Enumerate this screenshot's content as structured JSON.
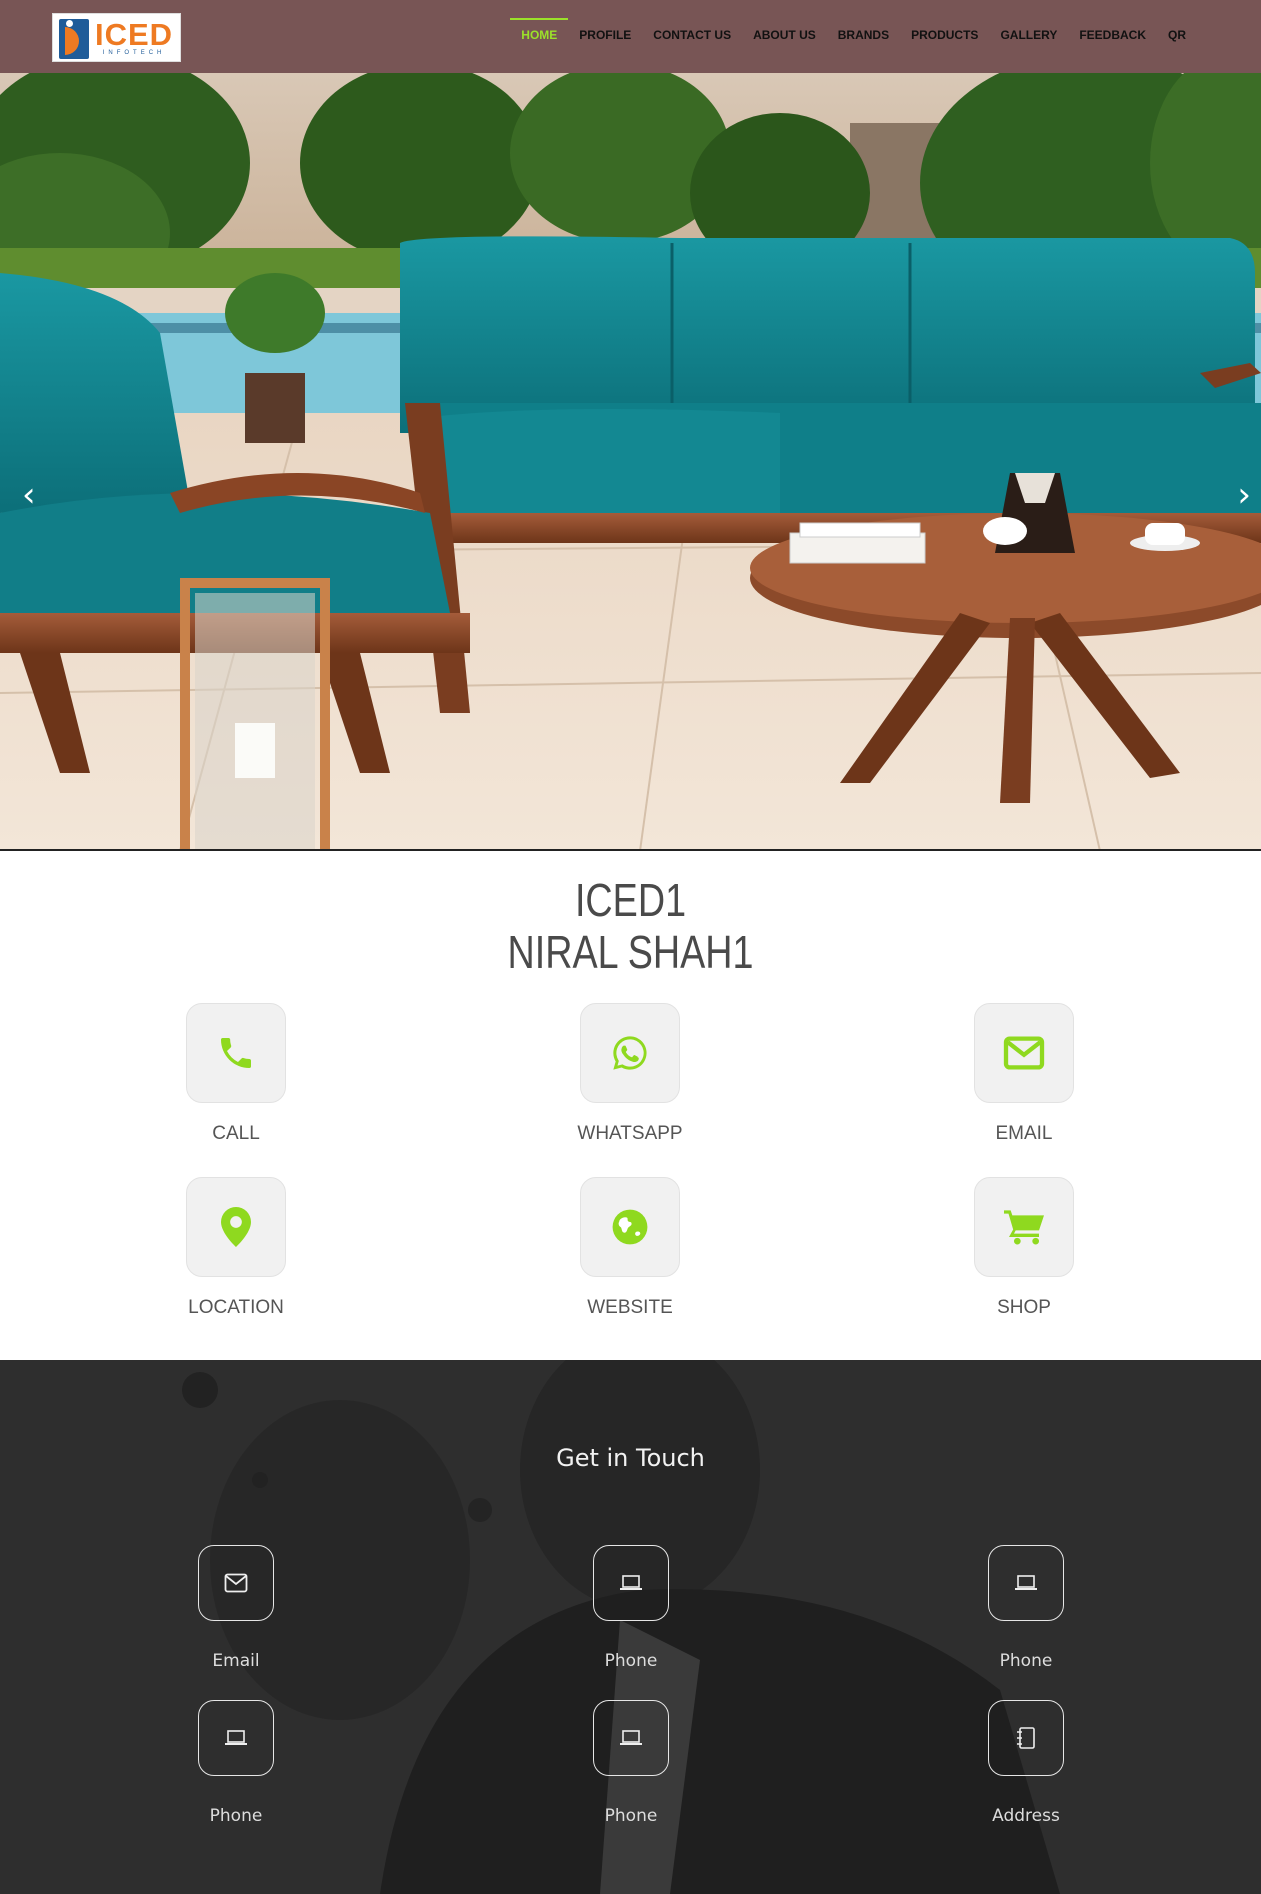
{
  "header": {
    "logo": {
      "text": "ICED",
      "subtext": "INFOTECH"
    },
    "nav": [
      "HOME",
      "PROFILE",
      "CONTACT US",
      "ABOUT US",
      "BRANDS",
      "PRODUCTS",
      "GALLERY",
      "FEEDBACK",
      "QR"
    ],
    "active_nav": "HOME"
  },
  "hero": {
    "prev_icon": "chevron-left-icon",
    "next_icon": "chevron-right-icon"
  },
  "profile": {
    "company": "ICED1",
    "person": "NIRAL SHAH1"
  },
  "actions": [
    {
      "label": "CALL",
      "icon": "phone-icon"
    },
    {
      "label": "WHATSAPP",
      "icon": "whatsapp-icon"
    },
    {
      "label": "EMAIL",
      "icon": "envelope-icon"
    },
    {
      "label": "LOCATION",
      "icon": "map-pin-icon"
    },
    {
      "label": "WEBSITE",
      "icon": "globe-icon"
    },
    {
      "label": "SHOP",
      "icon": "cart-icon"
    }
  ],
  "touch": {
    "title": "Get in Touch",
    "items": [
      {
        "label": "Email",
        "icon": "envelope-icon"
      },
      {
        "label": "Phone",
        "icon": "laptop-icon"
      },
      {
        "label": "Phone",
        "icon": "laptop-icon"
      },
      {
        "label": "Phone",
        "icon": "laptop-icon"
      },
      {
        "label": "Phone",
        "icon": "laptop-icon"
      },
      {
        "label": "Address",
        "icon": "address-book-icon"
      }
    ]
  },
  "colors": {
    "header_bg": "#785555",
    "accent": "#9be12a",
    "logo_orange": "#ee7a22",
    "logo_blue": "#1f5c99",
    "dark_bg": "#2f2f2f"
  }
}
